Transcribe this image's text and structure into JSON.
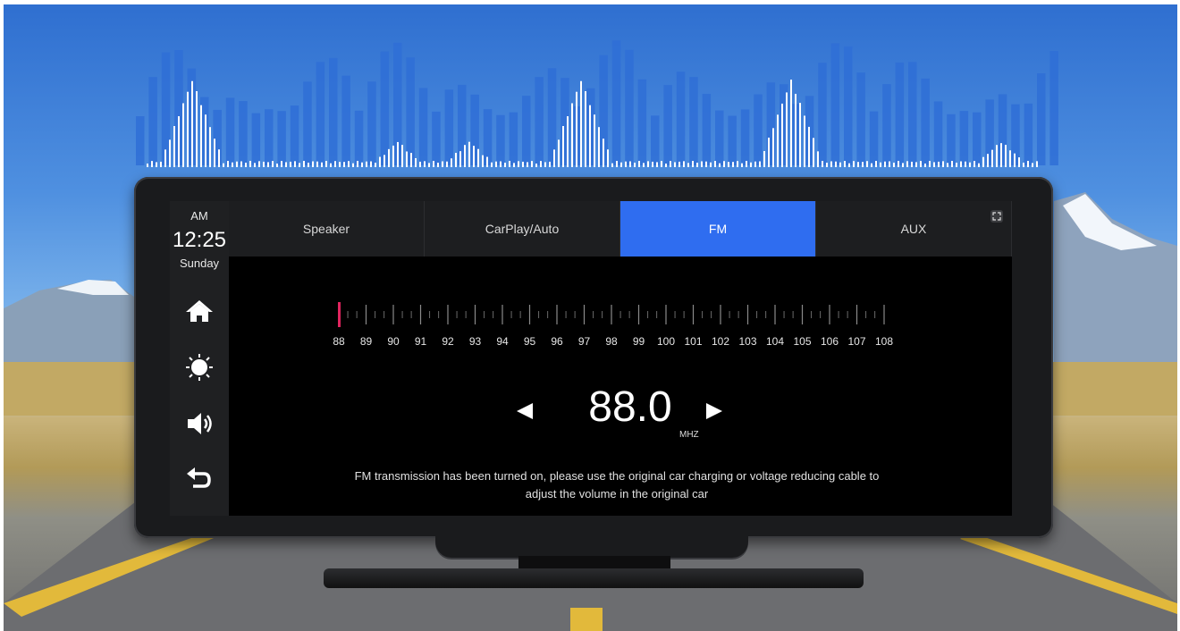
{
  "status": {
    "ampm": "AM",
    "time": "12:25",
    "day": "Sunday"
  },
  "sidebar": {
    "items": [
      {
        "icon": "home-icon"
      },
      {
        "icon": "brightness-icon"
      },
      {
        "icon": "volume-icon"
      },
      {
        "icon": "back-icon"
      }
    ]
  },
  "tabs": [
    {
      "label": "Speaker",
      "active": false
    },
    {
      "label": "CarPlay/Auto",
      "active": false
    },
    {
      "label": "FM",
      "active": true
    },
    {
      "label": "AUX",
      "active": false
    }
  ],
  "fm": {
    "scale_labels": [
      "88",
      "89",
      "90",
      "91",
      "92",
      "93",
      "94",
      "95",
      "96",
      "97",
      "98",
      "99",
      "100",
      "101",
      "102",
      "103",
      "104",
      "105",
      "106",
      "107",
      "108"
    ],
    "frequency": "88.0",
    "unit": "MHZ",
    "notice_line1": "FM transmission has been turned on, please use the original car charging or voltage reducing cable to",
    "notice_line2": "adjust the volume in the original car"
  },
  "colors": {
    "accent": "#2f6df0",
    "needle": "#e0245e",
    "spectrum": "#2f6fd6"
  }
}
